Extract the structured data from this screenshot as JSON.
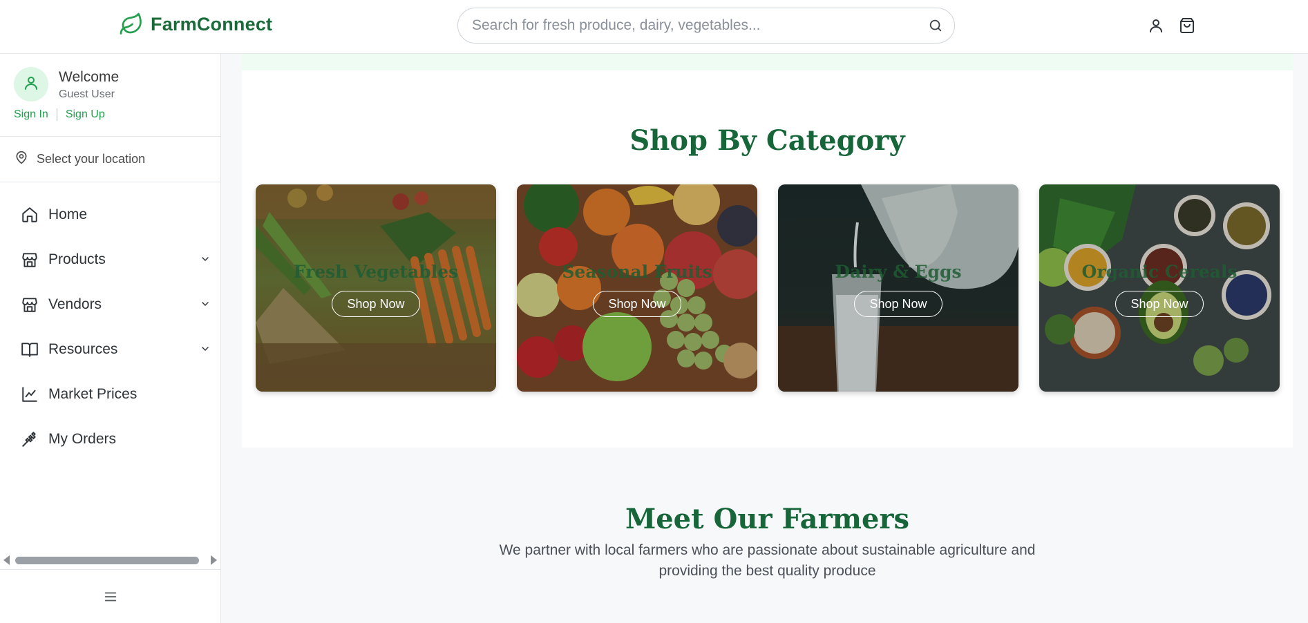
{
  "header": {
    "logo_text": "FarmConnect",
    "search_placeholder": "Search for fresh produce, dairy, vegetables...",
    "search_value": "",
    "icons": [
      "search-icon",
      "user-icon",
      "shopping-bag-icon"
    ]
  },
  "sidebar": {
    "welcome_title": "Welcome",
    "welcome_subtitle": "Guest User",
    "sign_in": "Sign In",
    "sign_up": "Sign Up",
    "location_label": "Select your location",
    "items": [
      {
        "label": "Home",
        "icon": "home-icon",
        "has_submenu": false
      },
      {
        "label": "Products",
        "icon": "store-icon",
        "has_submenu": true
      },
      {
        "label": "Vendors",
        "icon": "store-icon",
        "has_submenu": true
      },
      {
        "label": "Resources",
        "icon": "book-icon",
        "has_submenu": true
      },
      {
        "label": "Market Prices",
        "icon": "chart-line-icon",
        "has_submenu": false
      },
      {
        "label": "My Orders",
        "icon": "wheat-icon",
        "has_submenu": false
      }
    ]
  },
  "main": {
    "category_title": "Shop By Category",
    "categories": [
      {
        "label": "Fresh Vegetables",
        "button": "Shop Now"
      },
      {
        "label": "Seasonal Fruits",
        "button": "Shop Now"
      },
      {
        "label": "Dairy & Eggs",
        "button": "Shop Now"
      },
      {
        "label": "Organic Cereals",
        "button": "Shop Now"
      }
    ],
    "farmers_title": "Meet Our Farmers",
    "farmers_subtitle": "We partner with local farmers who are passionate about sustainable agriculture and providing the best quality produce"
  },
  "colors": {
    "brand": "#1b6b3a",
    "accent": "#23a04f",
    "heading": "#17663a",
    "avatar_bg": "#ddf6e6"
  }
}
